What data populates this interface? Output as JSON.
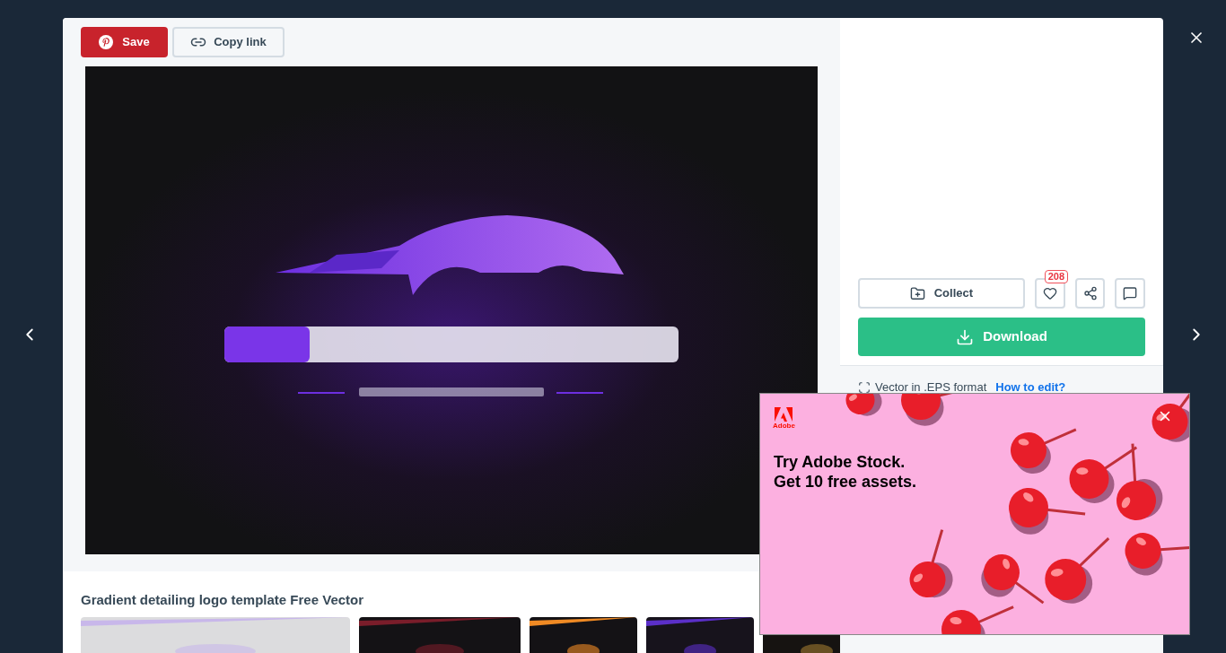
{
  "share_buttons": [
    {
      "label": "Save",
      "kind": "pinterest"
    },
    {
      "label": "Copy link",
      "kind": "link"
    }
  ],
  "title": "Gradient detailing logo template Free Vector",
  "actions": {
    "collect": "Collect",
    "like_count": "208",
    "download": "Download"
  },
  "format": {
    "text": "Vector in .EPS format",
    "link": "How to edit?"
  },
  "ad": {
    "brand": "Adobe",
    "headline": "Try Adobe Stock.",
    "subline": "Get 10 free assets."
  }
}
